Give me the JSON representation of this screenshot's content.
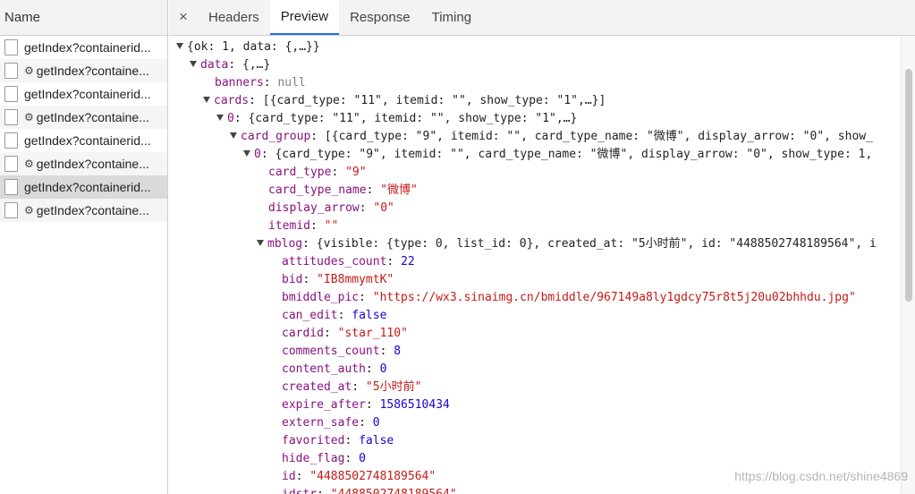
{
  "left": {
    "header": "Name",
    "requests": [
      {
        "label": "getIndex?containerid...",
        "gear": false
      },
      {
        "label": "getIndex?containe...",
        "gear": true
      },
      {
        "label": "getIndex?containerid...",
        "gear": false
      },
      {
        "label": "getIndex?containe...",
        "gear": true
      },
      {
        "label": "getIndex?containerid...",
        "gear": false
      },
      {
        "label": "getIndex?containe...",
        "gear": true
      },
      {
        "label": "getIndex?containerid...",
        "gear": false
      },
      {
        "label": "getIndex?containe...",
        "gear": true
      }
    ]
  },
  "tabs": {
    "close": "×",
    "items": [
      "Headers",
      "Preview",
      "Response",
      "Timing"
    ],
    "active": "Preview"
  },
  "json_lines": [
    {
      "indent": 0,
      "tri": true,
      "parts": [
        [
          "p",
          "{ok: 1, data: {,…}}"
        ]
      ]
    },
    {
      "indent": 1,
      "tri": true,
      "parts": [
        [
          "k",
          "data"
        ],
        [
          "p",
          ": {,…}"
        ]
      ]
    },
    {
      "indent": 2,
      "tri": false,
      "parts": [
        [
          "k",
          "banners"
        ],
        [
          "p",
          ": "
        ],
        [
          "nul",
          "null"
        ]
      ]
    },
    {
      "indent": 2,
      "tri": true,
      "parts": [
        [
          "k",
          "cards"
        ],
        [
          "p",
          ": [{card_type: \"11\", itemid: \"\", show_type: \"1\",…}]"
        ]
      ]
    },
    {
      "indent": 3,
      "tri": true,
      "parts": [
        [
          "k",
          "0"
        ],
        [
          "p",
          ": {card_type: \"11\", itemid: \"\", show_type: \"1\",…}"
        ]
      ]
    },
    {
      "indent": 4,
      "tri": true,
      "parts": [
        [
          "k",
          "card_group"
        ],
        [
          "p",
          ": [{card_type: \"9\", itemid: \"\", card_type_name: \"微博\", display_arrow: \"0\", show_"
        ]
      ]
    },
    {
      "indent": 5,
      "tri": true,
      "parts": [
        [
          "k",
          "0"
        ],
        [
          "p",
          ": {card_type: \"9\", itemid: \"\", card_type_name: \"微博\", display_arrow: \"0\", show_type: 1,"
        ]
      ]
    },
    {
      "indent": 6,
      "tri": false,
      "parts": [
        [
          "k",
          "card_type"
        ],
        [
          "p",
          ": "
        ],
        [
          "s",
          "\"9\""
        ]
      ]
    },
    {
      "indent": 6,
      "tri": false,
      "parts": [
        [
          "k",
          "card_type_name"
        ],
        [
          "p",
          ": "
        ],
        [
          "s",
          "\"微博\""
        ]
      ]
    },
    {
      "indent": 6,
      "tri": false,
      "parts": [
        [
          "k",
          "display_arrow"
        ],
        [
          "p",
          ": "
        ],
        [
          "s",
          "\"0\""
        ]
      ]
    },
    {
      "indent": 6,
      "tri": false,
      "parts": [
        [
          "k",
          "itemid"
        ],
        [
          "p",
          ": "
        ],
        [
          "s",
          "\"\""
        ]
      ]
    },
    {
      "indent": 6,
      "tri": true,
      "parts": [
        [
          "k",
          "mblog"
        ],
        [
          "p",
          ": {visible: {type: 0, list_id: 0}, created_at: \"5小时前\", id: \"4488502748189564\", i"
        ]
      ]
    },
    {
      "indent": 7,
      "tri": false,
      "parts": [
        [
          "k",
          "attitudes_count"
        ],
        [
          "p",
          ": "
        ],
        [
          "n",
          "22"
        ]
      ]
    },
    {
      "indent": 7,
      "tri": false,
      "parts": [
        [
          "k",
          "bid"
        ],
        [
          "p",
          ": "
        ],
        [
          "s",
          "\"IB8mmymtK\""
        ]
      ]
    },
    {
      "indent": 7,
      "tri": false,
      "parts": [
        [
          "k",
          "bmiddle_pic"
        ],
        [
          "p",
          ": "
        ],
        [
          "s",
          "\"https://wx3.sinaimg.cn/bmiddle/967149a8ly1gdcy75r8t5j20u02bhhdu.jpg\""
        ]
      ]
    },
    {
      "indent": 7,
      "tri": false,
      "parts": [
        [
          "k",
          "can_edit"
        ],
        [
          "p",
          ": "
        ],
        [
          "n",
          "false"
        ]
      ]
    },
    {
      "indent": 7,
      "tri": false,
      "parts": [
        [
          "k",
          "cardid"
        ],
        [
          "p",
          ": "
        ],
        [
          "s",
          "\"star_110\""
        ]
      ]
    },
    {
      "indent": 7,
      "tri": false,
      "parts": [
        [
          "k",
          "comments_count"
        ],
        [
          "p",
          ": "
        ],
        [
          "n",
          "8"
        ]
      ]
    },
    {
      "indent": 7,
      "tri": false,
      "parts": [
        [
          "k",
          "content_auth"
        ],
        [
          "p",
          ": "
        ],
        [
          "n",
          "0"
        ]
      ]
    },
    {
      "indent": 7,
      "tri": false,
      "parts": [
        [
          "k",
          "created_at"
        ],
        [
          "p",
          ": "
        ],
        [
          "s",
          "\"5小时前\""
        ]
      ]
    },
    {
      "indent": 7,
      "tri": false,
      "parts": [
        [
          "k",
          "expire_after"
        ],
        [
          "p",
          ": "
        ],
        [
          "n",
          "1586510434"
        ]
      ]
    },
    {
      "indent": 7,
      "tri": false,
      "parts": [
        [
          "k",
          "extern_safe"
        ],
        [
          "p",
          ": "
        ],
        [
          "n",
          "0"
        ]
      ]
    },
    {
      "indent": 7,
      "tri": false,
      "parts": [
        [
          "k",
          "favorited"
        ],
        [
          "p",
          ": "
        ],
        [
          "n",
          "false"
        ]
      ]
    },
    {
      "indent": 7,
      "tri": false,
      "parts": [
        [
          "k",
          "hide_flag"
        ],
        [
          "p",
          ": "
        ],
        [
          "n",
          "0"
        ]
      ]
    },
    {
      "indent": 7,
      "tri": false,
      "parts": [
        [
          "k",
          "id"
        ],
        [
          "p",
          ": "
        ],
        [
          "s",
          "\"4488502748189564\""
        ]
      ]
    },
    {
      "indent": 7,
      "tri": false,
      "parts": [
        [
          "k",
          "idstr"
        ],
        [
          "p",
          ": "
        ],
        [
          "s",
          "\"4488502748189564\""
        ]
      ]
    }
  ],
  "watermark": "https://blog.csdn.net/shine4869"
}
